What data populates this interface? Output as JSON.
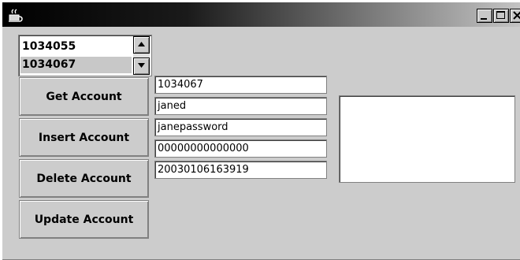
{
  "window": {
    "icon": "java-cup-icon",
    "title": "",
    "controls": [
      "minimize-icon",
      "maximize-icon",
      "close-icon"
    ]
  },
  "account_list": {
    "items": [
      "1034055",
      "1034067"
    ],
    "selected_index": 1
  },
  "buttons": {
    "get": "Get Account",
    "insert": "Insert Account",
    "delete": "Delete Account",
    "update": "Update Account"
  },
  "fields": {
    "account_id": "1034067",
    "username": "janed",
    "password": "janepassword",
    "number": "00000000000000",
    "timestamp": "20030106163919"
  },
  "output_area": {
    "text": ""
  }
}
